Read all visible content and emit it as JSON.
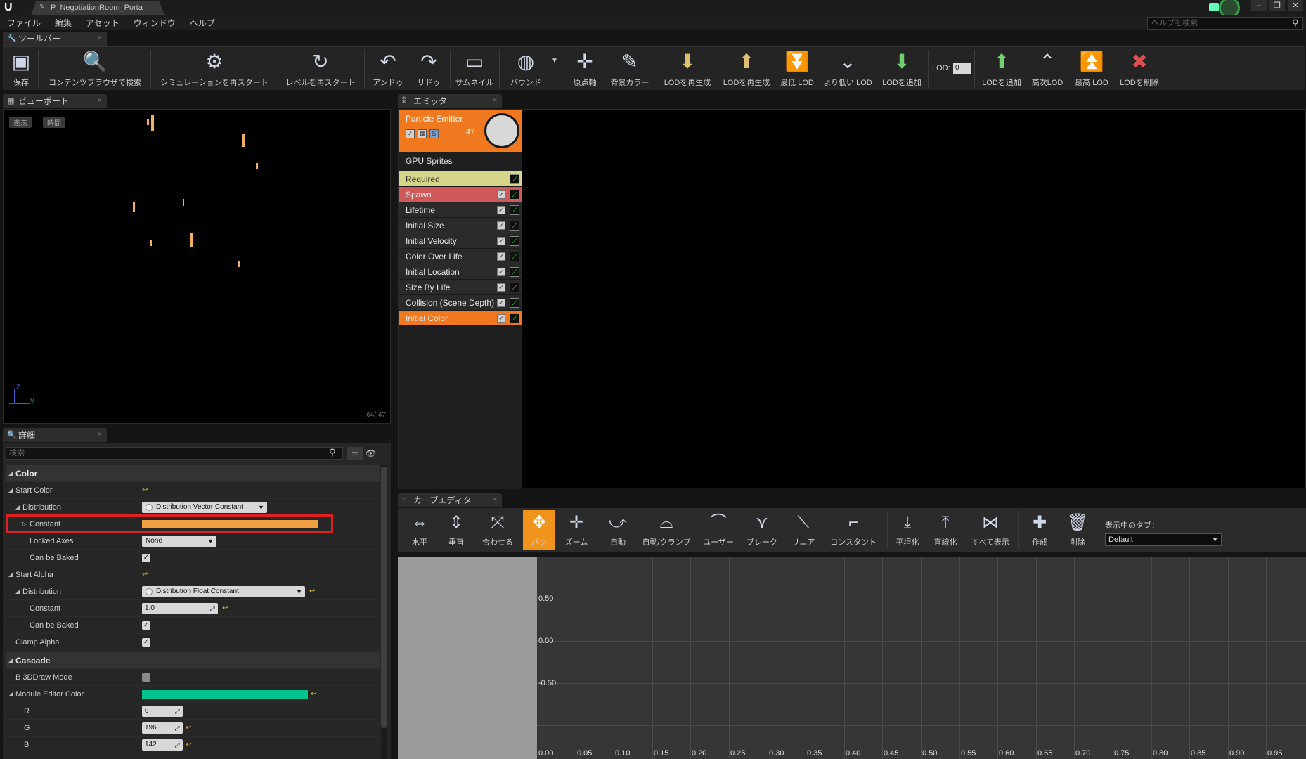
{
  "window": {
    "doc_tab": "P_NegotiationRoom_Porta",
    "controls": [
      "–",
      "❐",
      "✕"
    ]
  },
  "menu": [
    "ファイル",
    "編集",
    "アセット",
    "ウィンドウ",
    "ヘルプ"
  ],
  "help_search": {
    "placeholder": "ヘルプを検索"
  },
  "toolbar": {
    "tab": "ツールバー",
    "buttons": [
      {
        "label": "保存",
        "icon": "save-icon"
      },
      {
        "label": "コンテンツブラウザで検索",
        "icon": "magnifier-icon"
      },
      {
        "label": "シミュレーションを再スタート",
        "icon": "gear-restart-icon"
      },
      {
        "label": "レベルを再スタート",
        "icon": "restart-icon"
      },
      {
        "label": "アンドゥ",
        "icon": "undo-icon"
      },
      {
        "label": "リドゥ",
        "icon": "redo-icon"
      },
      {
        "label": "サムネイル",
        "icon": "thumbnail-icon"
      },
      {
        "label": "バウンド",
        "icon": "bounds-icon"
      },
      {
        "label": "原点軸",
        "icon": "origin-axis-icon"
      },
      {
        "label": "背景カラー",
        "icon": "bg-color-icon"
      },
      {
        "label": "LODを再生成",
        "icon": "regen-lod-icon"
      },
      {
        "label": "LODを再生成",
        "icon": "regen-lod-2-icon"
      },
      {
        "label": "最低 LOD",
        "icon": "lowest-lod-icon"
      },
      {
        "label": "より低い LOD",
        "icon": "lower-lod-icon"
      },
      {
        "label": "LODを追加",
        "icon": "add-lod-icon"
      },
      {
        "label": "LODを追加",
        "icon": "add-lod-2-icon"
      },
      {
        "label": "高次LOD",
        "icon": "higher-lod-icon"
      },
      {
        "label": "最高 LOD",
        "icon": "highest-lod-icon"
      },
      {
        "label": "LODを削除",
        "icon": "delete-lod-icon"
      }
    ],
    "lod_label": "LOD:",
    "lod_value": "0"
  },
  "viewport": {
    "tab": "ビューポート",
    "btn_show": "表示",
    "btn_time": "時間",
    "count": "64/ 47",
    "axis_z": "Z",
    "axis_y": "Y"
  },
  "details": {
    "tab": "詳細",
    "search_placeholder": "検索",
    "color_category": "Color",
    "start_color": "Start Color",
    "distribution": "Distribution",
    "distribution_value": "Distribution Vector Constant",
    "constant": "Constant",
    "locked_axes": "Locked Axes",
    "locked_axes_value": "None",
    "can_be_baked": "Can be Baked",
    "start_alpha": "Start Alpha",
    "distribution_alpha_value": "Distribution Float Constant",
    "alpha_constant_value": "1.0",
    "clamp_alpha": "Clamp Alpha",
    "cascade_category": "Cascade",
    "b3d_draw_mode": "B 3DDraw Mode",
    "module_editor_color": "Module Editor Color",
    "r_label": "R",
    "r_value": "0",
    "g_label": "G",
    "g_value": "196",
    "b_label": "B",
    "b_value": "142",
    "constant_color": "#f0a040",
    "module_color": "#00c48e"
  },
  "emitter": {
    "tab": "エミッタ",
    "name": "Particle Emitter",
    "count": "47",
    "type": "GPU Sprites",
    "modules": [
      {
        "label": "Required"
      },
      {
        "label": "Spawn"
      },
      {
        "label": "Lifetime"
      },
      {
        "label": "Initial Size"
      },
      {
        "label": "Initial Velocity"
      },
      {
        "label": "Color Over Life"
      },
      {
        "label": "Initial Location"
      },
      {
        "label": "Size By Life"
      },
      {
        "label": "Collision (Scene Depth)"
      },
      {
        "label": "Initial Color"
      }
    ]
  },
  "curve_editor": {
    "tab": "カーブエディタ",
    "buttons": [
      {
        "label": "水平",
        "icon": "fit-horizontal-icon"
      },
      {
        "label": "垂直",
        "icon": "fit-vertical-icon"
      },
      {
        "label": "合わせる",
        "icon": "fit-icon"
      },
      {
        "label": "パン",
        "icon": "pan-icon"
      },
      {
        "label": "ズーム",
        "icon": "zoom-icon"
      },
      {
        "label": "自動",
        "icon": "auto-icon"
      },
      {
        "label": "自動/クランプ",
        "icon": "auto-clamp-icon"
      },
      {
        "label": "ユーザー",
        "icon": "user-icon"
      },
      {
        "label": "ブレーク",
        "icon": "break-icon"
      },
      {
        "label": "リニア",
        "icon": "linear-icon"
      },
      {
        "label": "コンスタント",
        "icon": "constant-icon"
      },
      {
        "label": "平坦化",
        "icon": "flatten-icon"
      },
      {
        "label": "直線化",
        "icon": "straighten-icon"
      },
      {
        "label": "すべて表示",
        "icon": "show-all-icon"
      },
      {
        "label": "作成",
        "icon": "create-icon"
      },
      {
        "label": "削除",
        "icon": "delete-icon"
      }
    ],
    "tab_label": "表示中のタブ：",
    "tab_value": "Default",
    "y_labels": [
      "0.50",
      "0.00",
      "-0.50"
    ],
    "x_labels": [
      "0.00",
      "0.05",
      "0.10",
      "0.15",
      "0.20",
      "0.25",
      "0.30",
      "0.35",
      "0.40",
      "0.45",
      "0.50",
      "0.55",
      "0.60",
      "0.65",
      "0.70",
      "0.75",
      "0.80",
      "0.85",
      "0.90",
      "0.95"
    ]
  }
}
